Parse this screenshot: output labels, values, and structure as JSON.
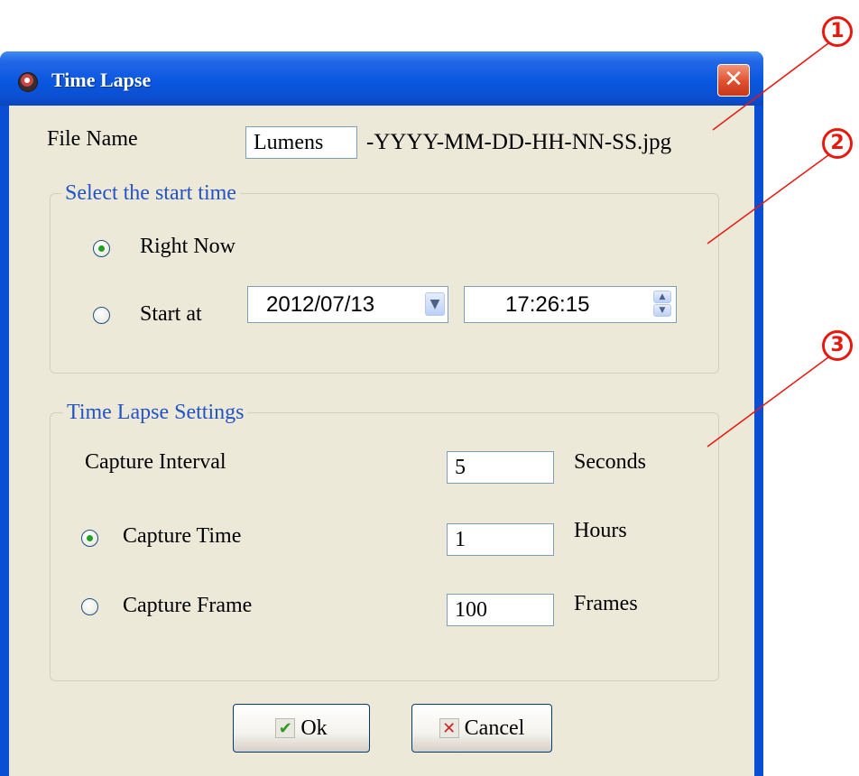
{
  "window": {
    "title": "Time Lapse",
    "close_glyph": "✕"
  },
  "file_name": {
    "label": "File Name",
    "value": "Lumens",
    "suffix": "-YYYY-MM-DD-HH-NN-SS.jpg"
  },
  "start_time": {
    "group_label": "Select the start time",
    "right_now_label": "Right Now",
    "start_at_label": "Start at",
    "selected": "right_now",
    "date_value": "2012/07/13",
    "time_value": "17:26:15"
  },
  "settings": {
    "group_label": "Time Lapse Settings",
    "interval_label": "Capture Interval",
    "interval_value": "5",
    "interval_unit": "Seconds",
    "capture_time_label": "Capture Time",
    "capture_time_value": "1",
    "capture_time_unit": "Hours",
    "capture_frame_label": "Capture Frame",
    "capture_frame_value": "100",
    "capture_frame_unit": "Frames",
    "selected": "capture_time"
  },
  "buttons": {
    "ok_label": "Ok",
    "cancel_label": "Cancel"
  },
  "icons": {
    "app": "ladybug-icon",
    "ok": "checkmark-icon",
    "cancel": "x-icon",
    "dropdown": "chevron-down-icon",
    "spinner": "spin-updown-icon"
  },
  "callouts": [
    "1",
    "2",
    "3"
  ],
  "colors": {
    "titlebar": "#0a57e0",
    "dialog_bg": "#ece9d8",
    "group_label": "#2453c6",
    "callout": "#e8180e",
    "radio_dot": "#21a121"
  }
}
